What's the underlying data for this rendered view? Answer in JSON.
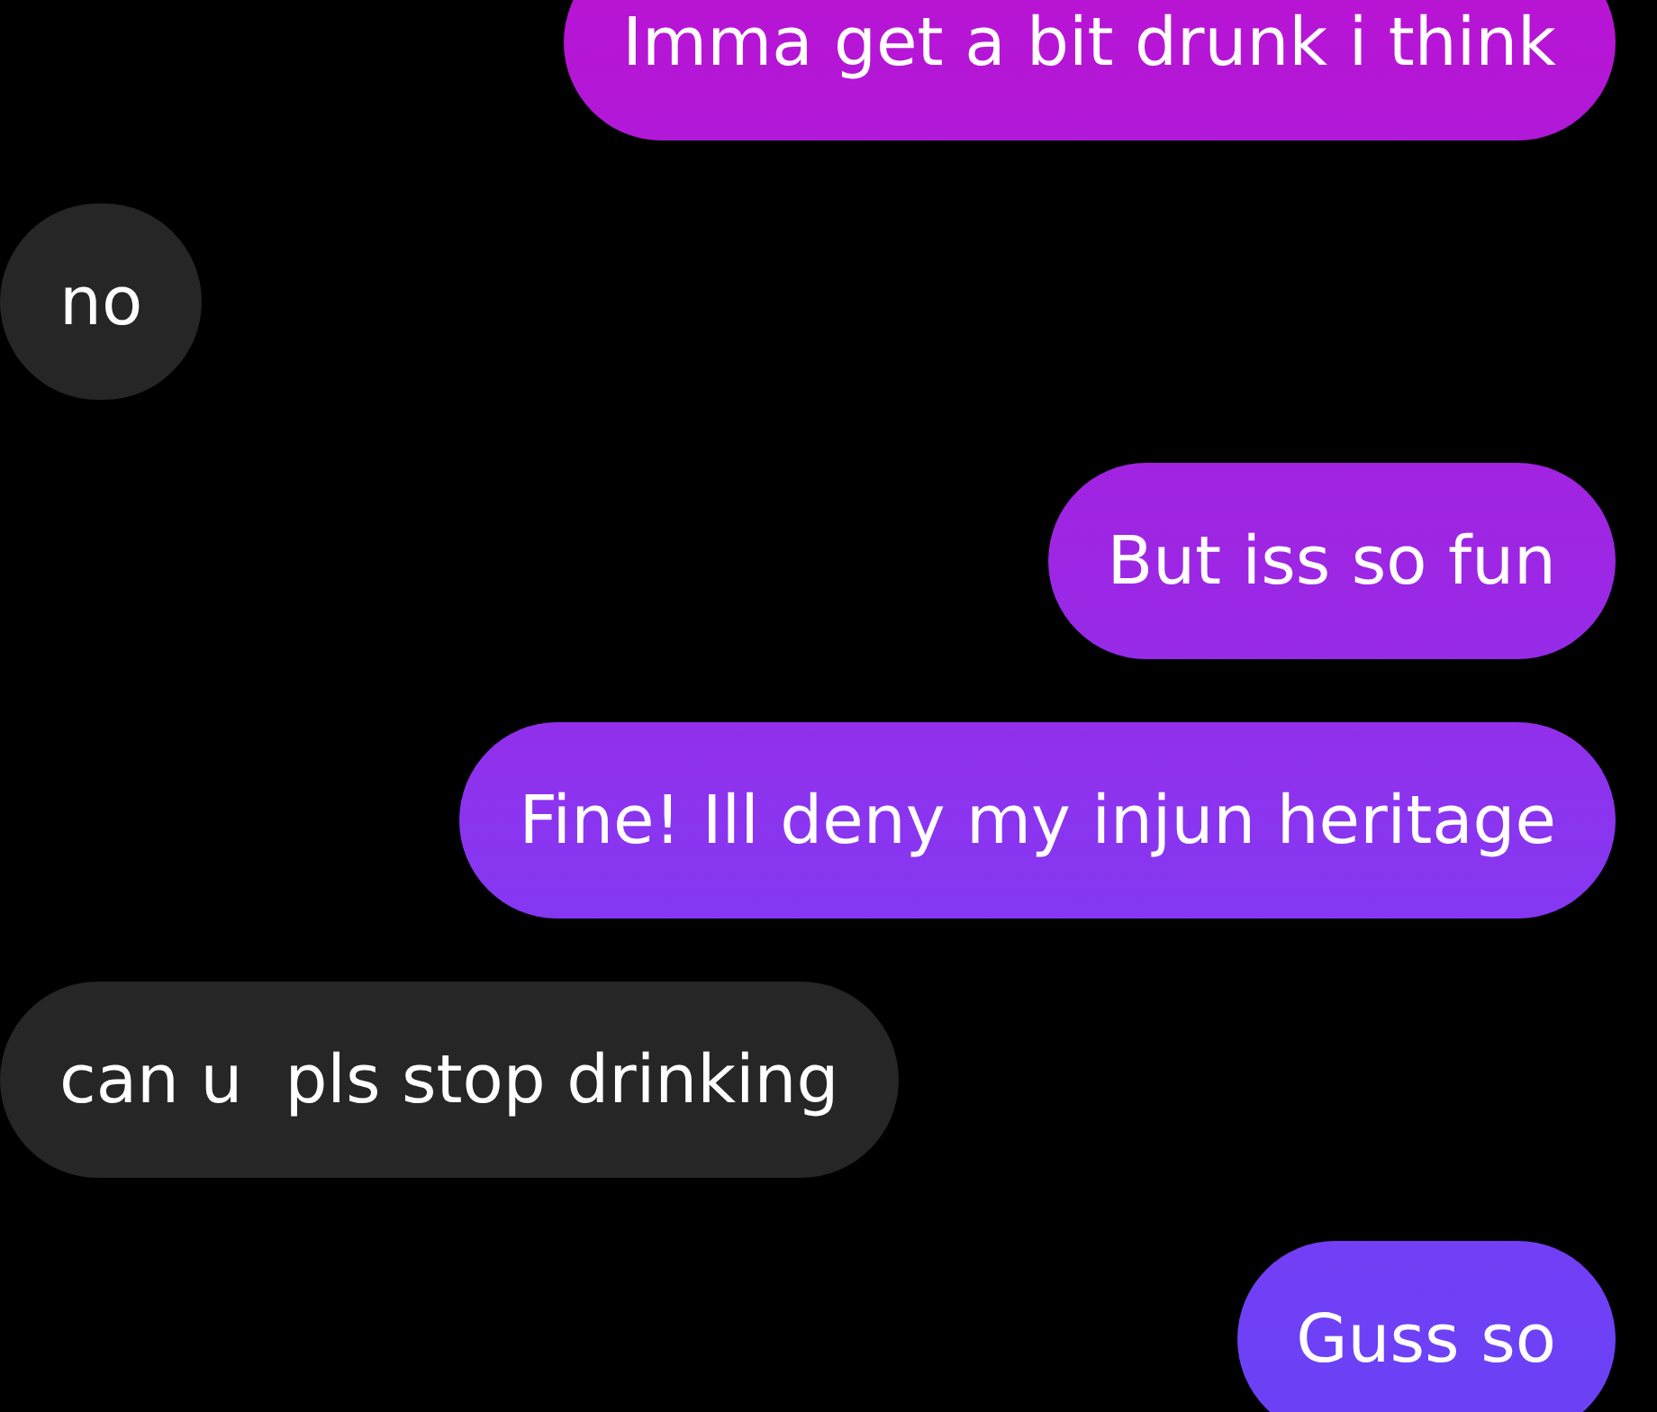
{
  "messages": [
    {
      "kind": "sent",
      "text": "Imma get a bit drunk i think"
    },
    {
      "kind": "received",
      "text": "no"
    },
    {
      "kind": "sent",
      "text": "But iss so fun"
    },
    {
      "kind": "sent",
      "text": "Fine! Ill deny my injun heritage"
    },
    {
      "kind": "received",
      "text": "can u  pls stop drinking"
    },
    {
      "kind": "sent",
      "text": "Guss so"
    }
  ]
}
